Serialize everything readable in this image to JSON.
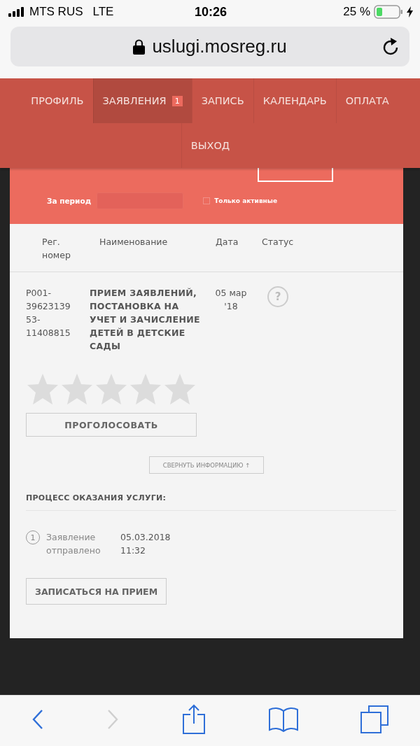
{
  "status_bar": {
    "carrier": "MTS RUS",
    "network": "LTE",
    "time": "10:26",
    "battery": "25 %"
  },
  "address_bar": {
    "url": "uslugi.mosreg.ru"
  },
  "nav": {
    "rows": [
      {
        "items": [
          {
            "label": "ПРОФИЛЬ",
            "selected": false
          },
          {
            "label": "ЗАЯВЛЕНИЯ",
            "selected": true,
            "badge": "1"
          },
          {
            "label": "ЗАПИСЬ",
            "selected": false
          },
          {
            "label": "КАЛЕНДАРЬ",
            "selected": false
          },
          {
            "label": "ОПЛАТА",
            "selected": false
          }
        ]
      },
      {
        "items": [
          {
            "label": "ВЫХОД",
            "selected": false
          }
        ]
      }
    ]
  },
  "filters": {
    "period_label": "За период",
    "only_active": {
      "label": "Только активные",
      "checked": false
    }
  },
  "table": {
    "columns": [
      "Рег. номер",
      "Наименование",
      "Дата",
      "Статус"
    ],
    "rows": [
      {
        "reg_number": "P001-3962313953-11408815",
        "name": "ПРИЕМ ЗАЯВЛЕНИЙ, ПОСТАНОВКА НА УЧЕТ И ЗАЧИСЛЕНИЕ ДЕТЕЙ В ДЕТСКИЕ САДЫ",
        "date": "05 мар '18",
        "status": "?",
        "stars": 0,
        "vote_button": "ПРОГОЛОСОВАТЬ",
        "collapse_button": "СВЕРНУТЬ ИНФОРМАЦИЮ ↑",
        "process": {
          "title": "ПРОЦЕСС ОКАЗАНИЯ УСЛУГИ:",
          "steps": [
            {
              "number": "1",
              "label": "Заявление отправлено",
              "date": "05.03.2018 11:32"
            }
          ]
        },
        "appointment_button": "ЗАПИСАТЬСЯ НА ПРИЕМ"
      }
    ]
  },
  "toolbar": {
    "buttons": [
      {
        "kind": "back",
        "disabled": false
      },
      {
        "kind": "forward",
        "disabled": true
      },
      {
        "kind": "share",
        "disabled": false
      },
      {
        "kind": "bookmarks",
        "disabled": false
      },
      {
        "kind": "tabs",
        "disabled": false
      }
    ]
  }
}
